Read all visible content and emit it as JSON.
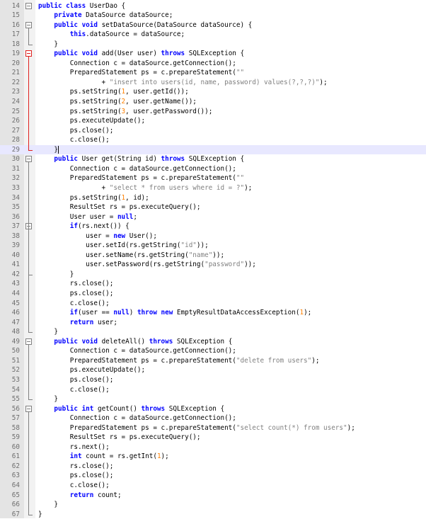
{
  "editor": {
    "line_numbers": [
      "14",
      "15",
      "16",
      "17",
      "18",
      "19",
      "20",
      "21",
      "22",
      "23",
      "24",
      "25",
      "26",
      "27",
      "28",
      "29",
      "30",
      "31",
      "32",
      "33",
      "34",
      "35",
      "36",
      "37",
      "38",
      "39",
      "40",
      "41",
      "42",
      "43",
      "44",
      "45",
      "46",
      "47",
      "48",
      "49",
      "50",
      "51",
      "52",
      "53",
      "54",
      "55",
      "56",
      "57",
      "58",
      "59",
      "60",
      "61",
      "62",
      "63",
      "64",
      "65",
      "66",
      "67"
    ],
    "colors": {
      "keyword": "#0000ff",
      "string": "#808080",
      "number": "#ff8000",
      "error_fold": "#e0201e",
      "current_line": "#e8e8ff"
    },
    "lines": [
      [
        {
          "t": "kw",
          "v": "public class"
        },
        {
          "t": "p",
          "v": " UserDao {"
        }
      ],
      [
        {
          "t": "p",
          "v": "    "
        },
        {
          "t": "kw",
          "v": "private"
        },
        {
          "t": "p",
          "v": " DataSource dataSource;"
        }
      ],
      [
        {
          "t": "p",
          "v": "    "
        },
        {
          "t": "kw",
          "v": "public void"
        },
        {
          "t": "p",
          "v": " setDataSource(DataSource dataSource) {"
        }
      ],
      [
        {
          "t": "p",
          "v": "        "
        },
        {
          "t": "kw",
          "v": "this"
        },
        {
          "t": "p",
          "v": ".dataSource = dataSource;"
        }
      ],
      [
        {
          "t": "p",
          "v": "    }"
        }
      ],
      [
        {
          "t": "p",
          "v": "    "
        },
        {
          "t": "kw",
          "v": "public void"
        },
        {
          "t": "p",
          "v": " add(User user) "
        },
        {
          "t": "kw",
          "v": "throws"
        },
        {
          "t": "p",
          "v": " SQLException {"
        }
      ],
      [
        {
          "t": "p",
          "v": "        Connection c = dataSource.getConnection();"
        }
      ],
      [
        {
          "t": "p",
          "v": "        PreparedStatement ps = c.prepareStatement("
        },
        {
          "t": "str",
          "v": "\"\""
        }
      ],
      [
        {
          "t": "p",
          "v": "                + "
        },
        {
          "t": "str",
          "v": "\"insert into users(id, name, password) values(?,?,?)\""
        },
        {
          "t": "p",
          "v": ");"
        }
      ],
      [
        {
          "t": "p",
          "v": "        ps.setString("
        },
        {
          "t": "num",
          "v": "1"
        },
        {
          "t": "p",
          "v": ", user.getId());"
        }
      ],
      [
        {
          "t": "p",
          "v": "        ps.setString("
        },
        {
          "t": "num",
          "v": "2"
        },
        {
          "t": "p",
          "v": ", user.getName());"
        }
      ],
      [
        {
          "t": "p",
          "v": "        ps.setString("
        },
        {
          "t": "num",
          "v": "3"
        },
        {
          "t": "p",
          "v": ", user.getPassword());"
        }
      ],
      [
        {
          "t": "p",
          "v": "        ps.executeUpdate();"
        }
      ],
      [
        {
          "t": "p",
          "v": "        ps.close();"
        }
      ],
      [
        {
          "t": "p",
          "v": "        c.close();"
        }
      ],
      [
        {
          "t": "p",
          "v": "    }"
        }
      ],
      [
        {
          "t": "p",
          "v": "    "
        },
        {
          "t": "kw",
          "v": "public"
        },
        {
          "t": "p",
          "v": " User get(String id) "
        },
        {
          "t": "kw",
          "v": "throws"
        },
        {
          "t": "p",
          "v": " SQLException {"
        }
      ],
      [
        {
          "t": "p",
          "v": "        Connection c = dataSource.getConnection();"
        }
      ],
      [
        {
          "t": "p",
          "v": "        PreparedStatement ps = c.prepareStatement("
        },
        {
          "t": "str",
          "v": "\"\""
        }
      ],
      [
        {
          "t": "p",
          "v": "                + "
        },
        {
          "t": "str",
          "v": "\"select * from users where id = ?\""
        },
        {
          "t": "p",
          "v": ");"
        }
      ],
      [
        {
          "t": "p",
          "v": "        ps.setString("
        },
        {
          "t": "num",
          "v": "1"
        },
        {
          "t": "p",
          "v": ", id);"
        }
      ],
      [
        {
          "t": "p",
          "v": "        ResultSet rs = ps.executeQuery();"
        }
      ],
      [
        {
          "t": "p",
          "v": "        User user = "
        },
        {
          "t": "kw",
          "v": "null"
        },
        {
          "t": "p",
          "v": ";"
        }
      ],
      [
        {
          "t": "p",
          "v": "        "
        },
        {
          "t": "kw",
          "v": "if"
        },
        {
          "t": "p",
          "v": "(rs.next()) {"
        }
      ],
      [
        {
          "t": "p",
          "v": "            user = "
        },
        {
          "t": "kw",
          "v": "new"
        },
        {
          "t": "p",
          "v": " User();"
        }
      ],
      [
        {
          "t": "p",
          "v": "            user.setId(rs.getString("
        },
        {
          "t": "str",
          "v": "\"id\""
        },
        {
          "t": "p",
          "v": "));"
        }
      ],
      [
        {
          "t": "p",
          "v": "            user.setName(rs.getString("
        },
        {
          "t": "str",
          "v": "\"name\""
        },
        {
          "t": "p",
          "v": "));"
        }
      ],
      [
        {
          "t": "p",
          "v": "            user.setPassword(rs.getString("
        },
        {
          "t": "str",
          "v": "\"password\""
        },
        {
          "t": "p",
          "v": "));"
        }
      ],
      [
        {
          "t": "p",
          "v": "        }"
        }
      ],
      [
        {
          "t": "p",
          "v": "        rs.close();"
        }
      ],
      [
        {
          "t": "p",
          "v": "        ps.close();"
        }
      ],
      [
        {
          "t": "p",
          "v": "        c.close();"
        }
      ],
      [
        {
          "t": "p",
          "v": "        "
        },
        {
          "t": "kw",
          "v": "if"
        },
        {
          "t": "p",
          "v": "(user == "
        },
        {
          "t": "kw",
          "v": "null"
        },
        {
          "t": "p",
          "v": ") "
        },
        {
          "t": "kw",
          "v": "throw new"
        },
        {
          "t": "p",
          "v": " EmptyResultDataAccessException("
        },
        {
          "t": "num",
          "v": "1"
        },
        {
          "t": "p",
          "v": ");"
        }
      ],
      [
        {
          "t": "p",
          "v": "        "
        },
        {
          "t": "kw",
          "v": "return"
        },
        {
          "t": "p",
          "v": " user;"
        }
      ],
      [
        {
          "t": "p",
          "v": "    }"
        }
      ],
      [
        {
          "t": "p",
          "v": "    "
        },
        {
          "t": "kw",
          "v": "public void"
        },
        {
          "t": "p",
          "v": " deleteAll() "
        },
        {
          "t": "kw",
          "v": "throws"
        },
        {
          "t": "p",
          "v": " SQLException {"
        }
      ],
      [
        {
          "t": "p",
          "v": "        Connection c = dataSource.getConnection();"
        }
      ],
      [
        {
          "t": "p",
          "v": "        PreparedStatement ps = c.prepareStatement("
        },
        {
          "t": "str",
          "v": "\"delete from users\""
        },
        {
          "t": "p",
          "v": ");"
        }
      ],
      [
        {
          "t": "p",
          "v": "        ps.executeUpdate();"
        }
      ],
      [
        {
          "t": "p",
          "v": "        ps.close();"
        }
      ],
      [
        {
          "t": "p",
          "v": "        c.close();"
        }
      ],
      [
        {
          "t": "p",
          "v": "    }"
        }
      ],
      [
        {
          "t": "p",
          "v": "    "
        },
        {
          "t": "kw",
          "v": "public int"
        },
        {
          "t": "p",
          "v": " getCount() "
        },
        {
          "t": "kw",
          "v": "throws"
        },
        {
          "t": "p",
          "v": " SQLException {"
        }
      ],
      [
        {
          "t": "p",
          "v": "        Connection c = dataSource.getConnection();"
        }
      ],
      [
        {
          "t": "p",
          "v": "        PreparedStatement ps = c.prepareStatement("
        },
        {
          "t": "str",
          "v": "\"select count(*) from users\""
        },
        {
          "t": "p",
          "v": ");"
        }
      ],
      [
        {
          "t": "p",
          "v": "        ResultSet rs = ps.executeQuery();"
        }
      ],
      [
        {
          "t": "p",
          "v": "        rs.next();"
        }
      ],
      [
        {
          "t": "p",
          "v": "        "
        },
        {
          "t": "kw",
          "v": "int"
        },
        {
          "t": "p",
          "v": " count = rs.getInt("
        },
        {
          "t": "num",
          "v": "1"
        },
        {
          "t": "p",
          "v": ");"
        }
      ],
      [
        {
          "t": "p",
          "v": "        rs.close();"
        }
      ],
      [
        {
          "t": "p",
          "v": "        ps.close();"
        }
      ],
      [
        {
          "t": "p",
          "v": "        c.close();"
        }
      ],
      [
        {
          "t": "p",
          "v": "        "
        },
        {
          "t": "kw",
          "v": "return"
        },
        {
          "t": "p",
          "v": " count;"
        }
      ],
      [
        {
          "t": "p",
          "v": "    }"
        }
      ],
      [
        {
          "t": "p",
          "v": "}"
        }
      ]
    ]
  }
}
